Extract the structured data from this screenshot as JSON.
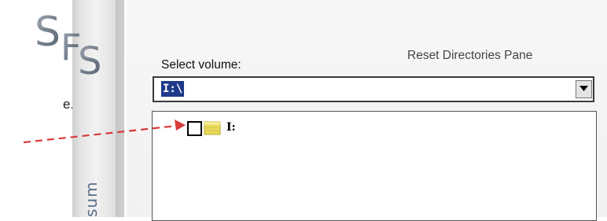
{
  "document": {
    "trailing_text": "e."
  },
  "logo": {
    "text": "SFS"
  },
  "sidebar": {
    "vertical_text": "sum"
  },
  "toolbar": {
    "reset_label": "Reset Directories Pane"
  },
  "volume_select": {
    "label": "Select volume:",
    "value": "I:\\",
    "arrow_icon": "chevron-down-icon"
  },
  "directories": {
    "items": [
      {
        "label": "I:",
        "checked": false,
        "icon": "folder-icon"
      }
    ]
  },
  "annotation": {
    "color": "#d93a3a",
    "style": "dashed-arrow"
  },
  "colors": {
    "selection": "#1e3a8a",
    "folder": "#e8d95a",
    "sidebar_text": "#5a6e87"
  }
}
